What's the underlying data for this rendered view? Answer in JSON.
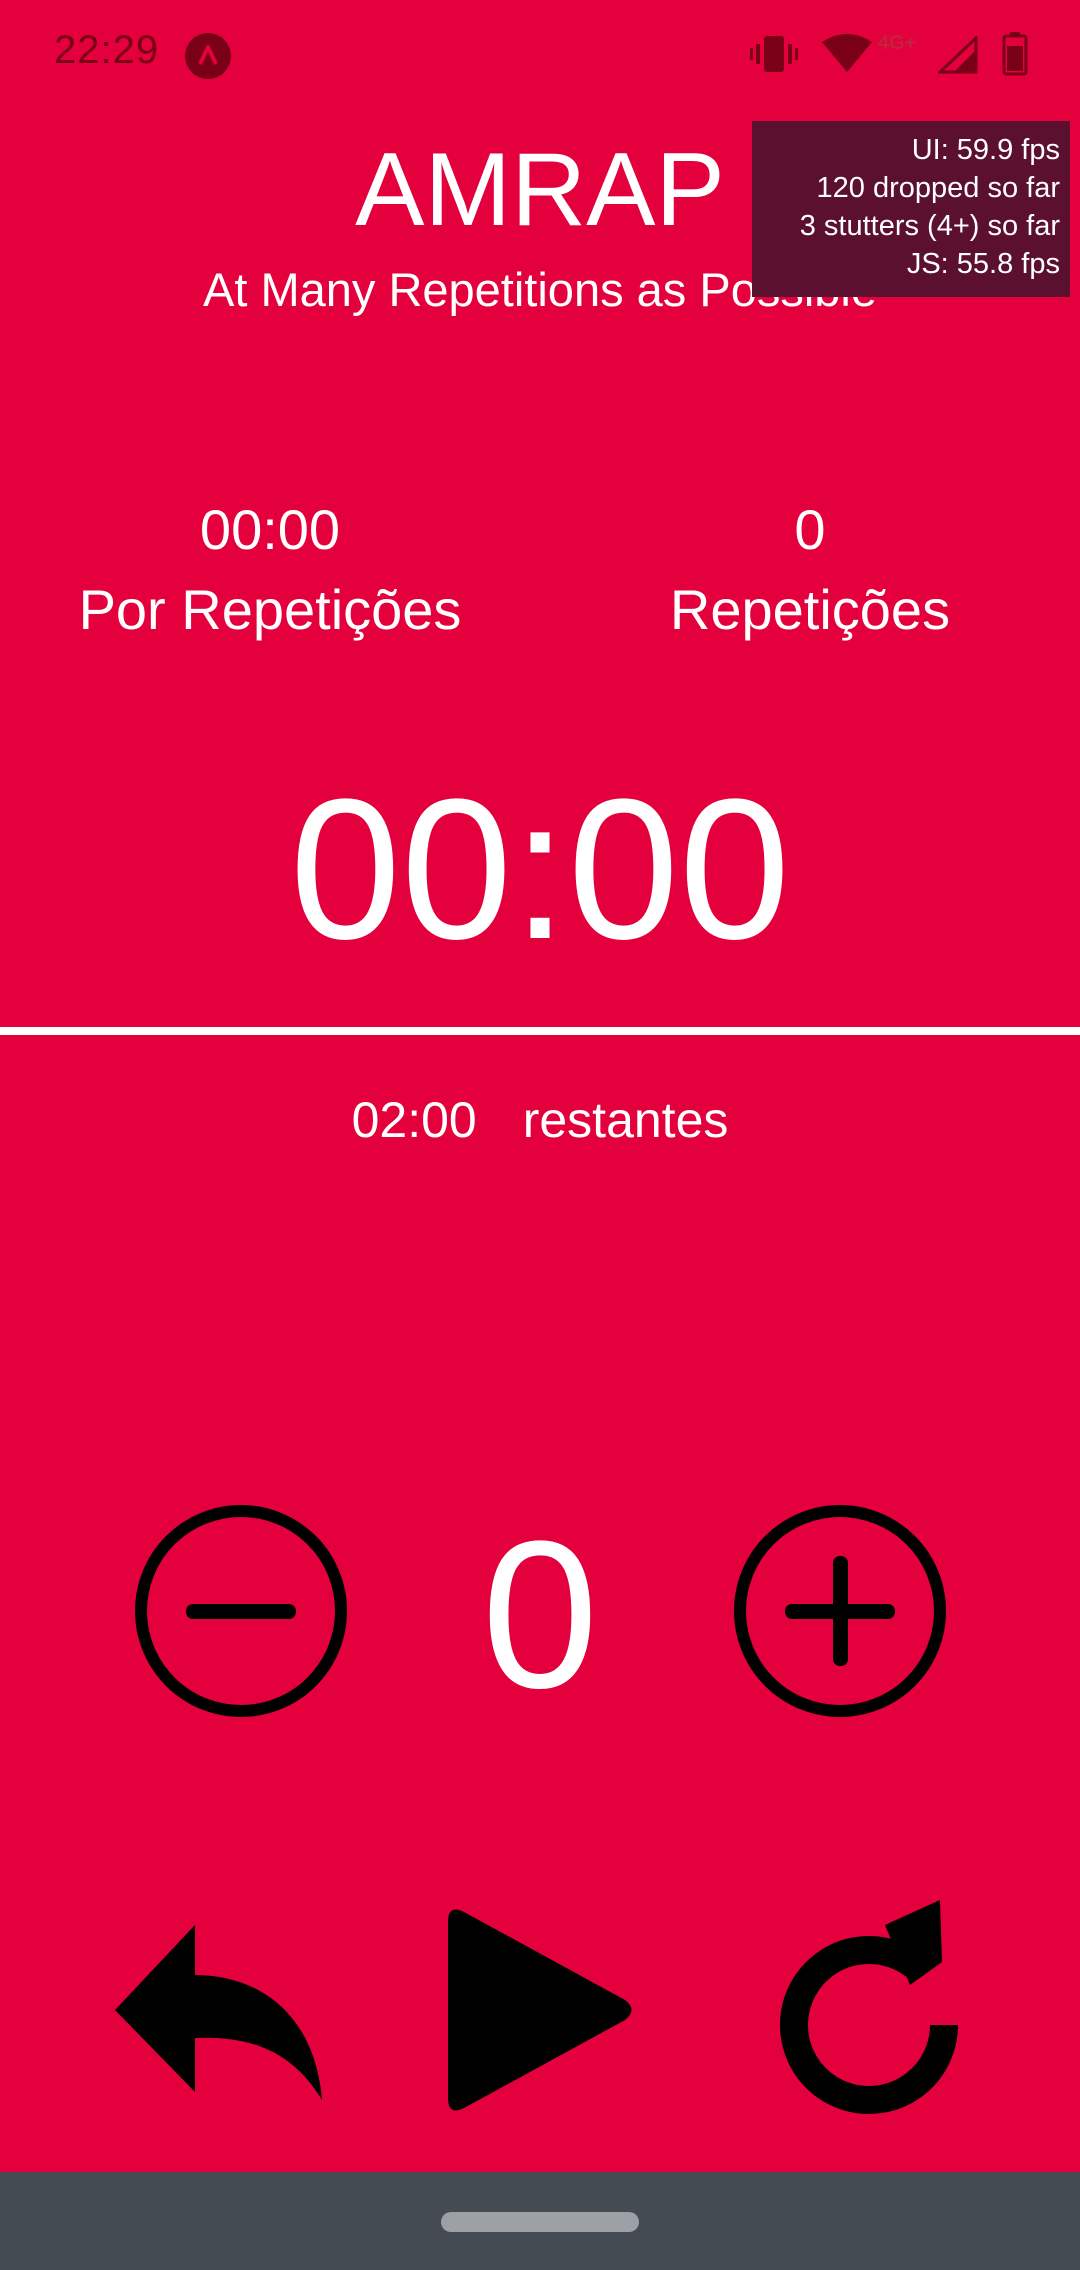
{
  "status_bar": {
    "time": "22:29",
    "network": "4G+"
  },
  "perf_overlay": {
    "ui_fps": "UI: 59.9 fps",
    "dropped": "120 dropped so far",
    "stutters": "3 stutters (4+) so far",
    "js_fps": "JS: 55.8 fps"
  },
  "header": {
    "title": "AMRAP",
    "subtitle": "At Many Repetitions as Possible"
  },
  "stats": {
    "per_rep_time": "00:00",
    "per_rep_label": "Por Repetições",
    "reps_value": "0",
    "reps_label": "Repetições"
  },
  "timer": {
    "elapsed": "00:00",
    "remaining_time": "02:00",
    "remaining_label": "restantes"
  },
  "counter": {
    "value": "0"
  },
  "colors": {
    "background": "#E3003C",
    "text": "#FFFFFF",
    "icons": "#000000",
    "nav_bar": "#454B52",
    "perf_overlay": "#5B1030"
  },
  "icons": {
    "decrement": "minus-circle-icon",
    "increment": "plus-circle-icon",
    "back": "reply-arrow-icon",
    "play": "play-icon",
    "reset": "refresh-icon"
  }
}
